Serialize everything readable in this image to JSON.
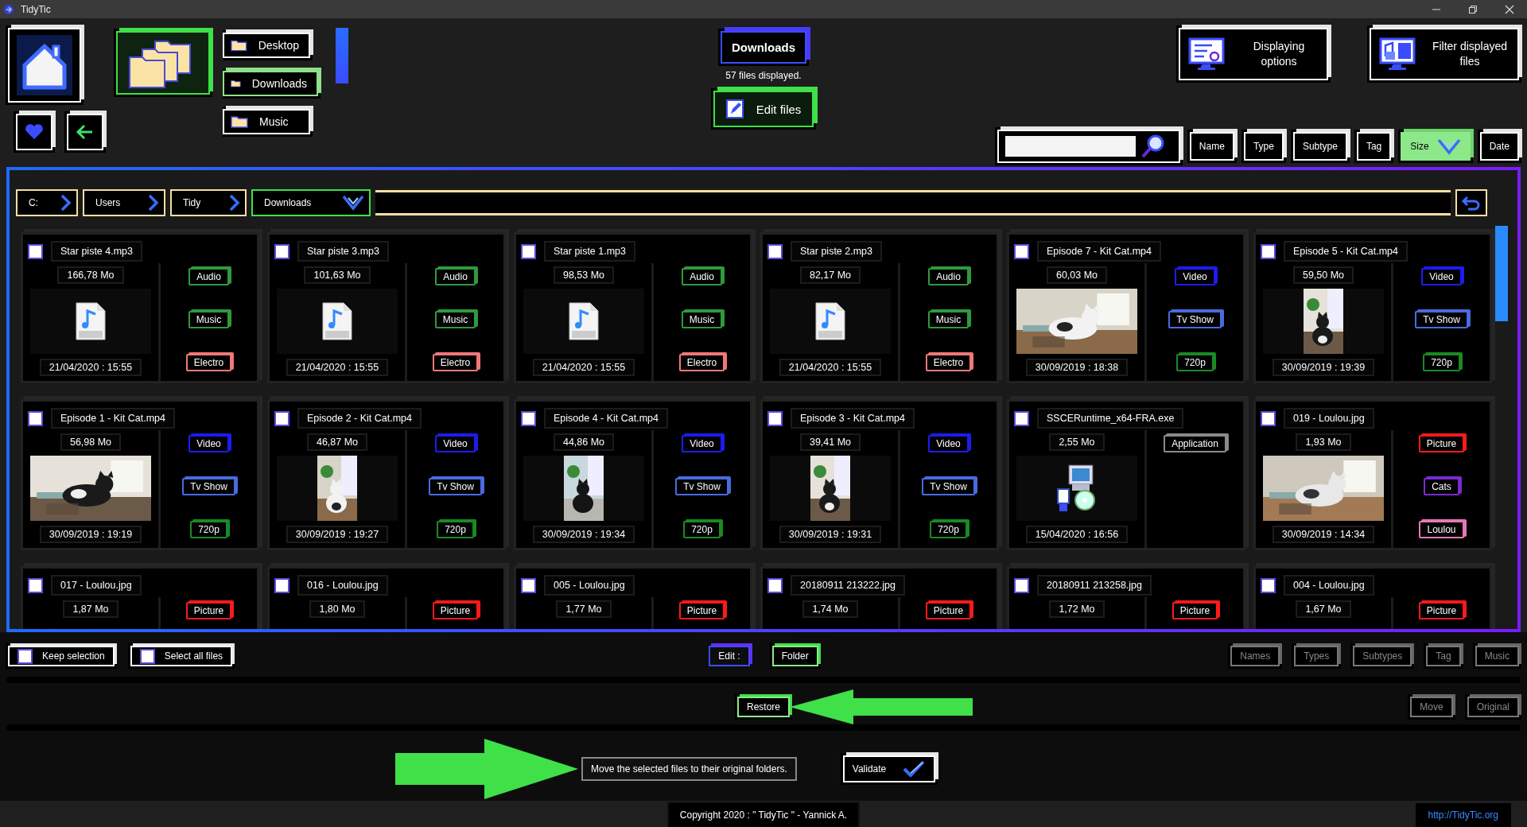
{
  "window": {
    "title": "TidyTic"
  },
  "locations": [
    {
      "label": "Desktop",
      "selected": false
    },
    {
      "label": "Downloads",
      "selected": true
    },
    {
      "label": "Music",
      "selected": false
    }
  ],
  "current_folder": {
    "name": "Downloads",
    "count": "57 files displayed."
  },
  "edit_files_button": "Edit files",
  "top_buttons": [
    {
      "kind": "display",
      "label": "Displaying options"
    },
    {
      "kind": "filter",
      "label": "Filter displayed files"
    }
  ],
  "sort_buttons": [
    {
      "label": "Name",
      "selected": false
    },
    {
      "label": "Type",
      "selected": false
    },
    {
      "label": "Subtype",
      "selected": false
    },
    {
      "label": "Tag",
      "selected": false
    },
    {
      "label": "Size",
      "selected": true
    },
    {
      "label": "Date",
      "selected": false
    }
  ],
  "breadcrumb": [
    {
      "label": "C:",
      "selected": false
    },
    {
      "label": "Users",
      "selected": false
    },
    {
      "label": "Tidy",
      "selected": false
    },
    {
      "label": "Downloads",
      "selected": true
    }
  ],
  "files": [
    {
      "name": "Star piste 4.mp3",
      "checked": false,
      "size": "166,78 Mo",
      "date": "21/04/2020 : 15:55",
      "kind": "audio",
      "tags": [
        {
          "label": "Audio",
          "color": "#2f9a3c"
        },
        {
          "label": "Music",
          "color": "#2f9a3c"
        },
        {
          "label": "Electro",
          "color": "#f07878"
        }
      ]
    },
    {
      "name": "Star piste 3.mp3",
      "checked": false,
      "size": "101,63 Mo",
      "date": "21/04/2020 : 15:55",
      "kind": "audio",
      "tags": [
        {
          "label": "Audio",
          "color": "#2f9a3c"
        },
        {
          "label": "Music",
          "color": "#2f9a3c"
        },
        {
          "label": "Electro",
          "color": "#f07878"
        }
      ]
    },
    {
      "name": "Star piste 1.mp3",
      "checked": false,
      "size": "98,53 Mo",
      "date": "21/04/2020 : 15:55",
      "kind": "audio",
      "tags": [
        {
          "label": "Audio",
          "color": "#2f9a3c"
        },
        {
          "label": "Music",
          "color": "#2f9a3c"
        },
        {
          "label": "Electro",
          "color": "#f07878"
        }
      ]
    },
    {
      "name": "Star piste 2.mp3",
      "checked": false,
      "size": "82,17 Mo",
      "date": "21/04/2020 : 15:55",
      "kind": "audio",
      "tags": [
        {
          "label": "Audio",
          "color": "#2f9a3c"
        },
        {
          "label": "Music",
          "color": "#2f9a3c"
        },
        {
          "label": "Electro",
          "color": "#f07878"
        }
      ]
    },
    {
      "name": "Episode 7 - Kit Cat.mp4",
      "checked": false,
      "size": "60,03 Mo",
      "date": "30/09/2019 : 18:38",
      "kind": "landscape",
      "tags": [
        {
          "label": "Video",
          "color": "#1c1cf0"
        },
        {
          "label": "Tv Show",
          "color": "#4a6ae0"
        },
        {
          "label": "720p",
          "color": "#1a8a24"
        }
      ]
    },
    {
      "name": "Episode 5 - Kit Cat.mp4",
      "checked": false,
      "size": "59,50 Mo",
      "date": "30/09/2019 : 19:39",
      "kind": "portrait",
      "tags": [
        {
          "label": "Video",
          "color": "#1c1cf0"
        },
        {
          "label": "Tv Show",
          "color": "#4a6ae0"
        },
        {
          "label": "720p",
          "color": "#1a8a24"
        }
      ]
    },
    {
      "name": "Episode 1 - Kit Cat.mp4",
      "checked": false,
      "size": "56,98 Mo",
      "date": "30/09/2019 : 19:19",
      "kind": "landscape",
      "tags": [
        {
          "label": "Video",
          "color": "#1c1cf0"
        },
        {
          "label": "Tv Show",
          "color": "#4a6ae0"
        },
        {
          "label": "720p",
          "color": "#1a8a24"
        }
      ]
    },
    {
      "name": "Episode 2 - Kit Cat.mp4",
      "checked": false,
      "size": "46,87 Mo",
      "date": "30/09/2019 : 19:27",
      "kind": "portrait",
      "tags": [
        {
          "label": "Video",
          "color": "#1c1cf0"
        },
        {
          "label": "Tv Show",
          "color": "#4a6ae0"
        },
        {
          "label": "720p",
          "color": "#1a8a24"
        }
      ]
    },
    {
      "name": "Episode 4 - Kit Cat.mp4",
      "checked": false,
      "size": "44,86 Mo",
      "date": "30/09/2019 : 19:34",
      "kind": "portrait",
      "tags": [
        {
          "label": "Video",
          "color": "#1c1cf0"
        },
        {
          "label": "Tv Show",
          "color": "#4a6ae0"
        },
        {
          "label": "720p",
          "color": "#1a8a24"
        }
      ]
    },
    {
      "name": "Episode 3 - Kit Cat.mp4",
      "checked": false,
      "size": "39,41 Mo",
      "date": "30/09/2019 : 19:31",
      "kind": "portrait",
      "tags": [
        {
          "label": "Video",
          "color": "#1c1cf0"
        },
        {
          "label": "Tv Show",
          "color": "#4a6ae0"
        },
        {
          "label": "720p",
          "color": "#1a8a24"
        }
      ]
    },
    {
      "name": "SSCERuntime_x64-FRA.exe",
      "checked": false,
      "size": "2,55 Mo",
      "date": "15/04/2020 : 16:56",
      "kind": "program",
      "tags": [
        {
          "label": "Application",
          "color": "#8a8a8a"
        }
      ]
    },
    {
      "name": "019 - Loulou.jpg",
      "checked": false,
      "size": "1,93 Mo",
      "date": "30/09/2019 : 14:34",
      "kind": "landscape",
      "tags": [
        {
          "label": "Picture",
          "color": "#ff1a1a"
        },
        {
          "label": "Cats",
          "color": "#7a2ad0"
        },
        {
          "label": "Loulou",
          "color": "#e27ab4"
        }
      ]
    },
    {
      "name": "017 - Loulou.jpg",
      "checked": false,
      "size": "1,87 Mo",
      "tags": [
        {
          "label": "Picture",
          "color": "#ff1a1a"
        }
      ]
    },
    {
      "name": "016 - Loulou.jpg",
      "checked": false,
      "size": "1,80 Mo",
      "tags": [
        {
          "label": "Picture",
          "color": "#ff1a1a"
        }
      ]
    },
    {
      "name": "005 - Loulou.jpg",
      "checked": false,
      "size": "1,77 Mo",
      "tags": [
        {
          "label": "Picture",
          "color": "#ff1a1a"
        }
      ]
    },
    {
      "name": "20180911 213222.jpg",
      "checked": false,
      "size": "1,74 Mo",
      "tags": [
        {
          "label": "Picture",
          "color": "#ff1a1a"
        }
      ]
    },
    {
      "name": "20180911 213258.jpg",
      "checked": false,
      "size": "1,72 Mo",
      "tags": [
        {
          "label": "Picture",
          "color": "#ff1a1a"
        }
      ]
    },
    {
      "name": "004 - Loulou.jpg",
      "checked": false,
      "size": "1,67 Mo",
      "tags": [
        {
          "label": "Picture",
          "color": "#ff1a1a"
        }
      ]
    }
  ],
  "selection_buttons": [
    {
      "label": "Keep selection",
      "checked": false
    },
    {
      "label": "Select all files",
      "checked": false
    }
  ],
  "edit_row": {
    "label": "Edit :",
    "current": "Folder",
    "modes": [
      {
        "label": "Names",
        "disabled": true
      },
      {
        "label": "Types",
        "disabled": true
      },
      {
        "label": "Subtypes",
        "disabled": true
      },
      {
        "label": "Tag",
        "disabled": true
      },
      {
        "label": "Music",
        "disabled": true
      }
    ]
  },
  "action_row": {
    "current": "Restore",
    "actions": [
      {
        "label": "Move",
        "disabled": true
      },
      {
        "label": "Original",
        "disabled": true
      }
    ]
  },
  "confirm": {
    "description": "Move the selected files to their original folders.",
    "validate": "Validate"
  },
  "footer": {
    "copyright": "Copyright 2020 : \" TidyTic \" - Yannick A.",
    "link": "http://TidyTic.org"
  }
}
